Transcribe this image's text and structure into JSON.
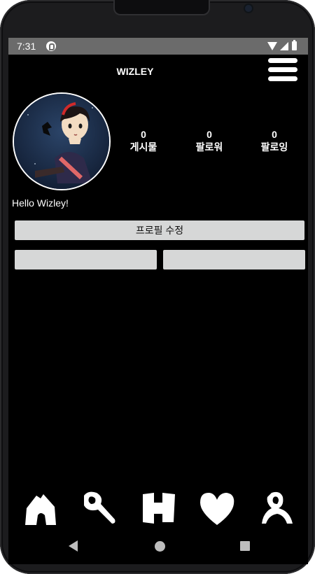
{
  "status_bar": {
    "time": "7:31"
  },
  "header": {
    "title": "WIZLEY"
  },
  "profile": {
    "stats": [
      {
        "count": "0",
        "label": "게시물"
      },
      {
        "count": "0",
        "label": "팔로워"
      },
      {
        "count": "0",
        "label": "팔로잉"
      }
    ],
    "bio": "Hello Wizley!",
    "edit_button_label": "프로필 수정",
    "secondary_buttons": [
      "",
      ""
    ]
  },
  "tab_bar": {
    "items": [
      "home-icon",
      "search-icon",
      "add-icon",
      "heart-icon",
      "profile-icon"
    ]
  },
  "colors": {
    "background": "#000000",
    "button": "#d6d7d7",
    "status_bar": "#6b6b6b"
  }
}
